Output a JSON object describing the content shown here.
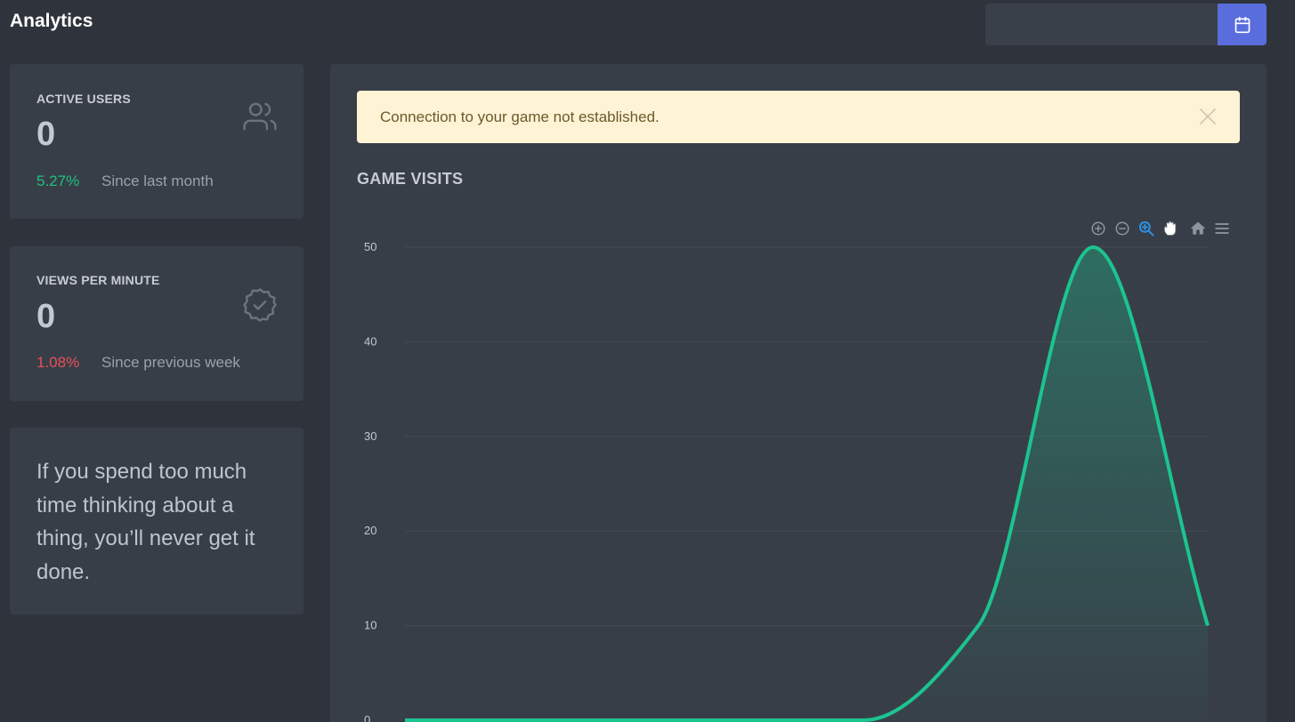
{
  "header": {
    "title": "Analytics",
    "date_value": "",
    "date_icon": "calendar-icon"
  },
  "stats": [
    {
      "title": "ACTIVE USERS",
      "value": "0",
      "change": "5.27%",
      "change_color": "#1fc17b",
      "since": "Since last month",
      "icon": "users-icon"
    },
    {
      "title": "VIEWS PER MINUTE",
      "value": "0",
      "change": "1.08%",
      "change_color": "#e9505a",
      "since": "Since previous week",
      "icon": "badge-check-icon"
    }
  ],
  "quote": {
    "text": "If you spend too much time thinking about a thing, you’ll never get it done."
  },
  "alert": {
    "message": "Connection to your game not established.",
    "close_icon": "close-icon"
  },
  "section": {
    "title": "GAME VISITS"
  },
  "toolbar": {
    "tools": [
      "zoom-in-icon",
      "zoom-out-icon",
      "selection-zoom-icon",
      "pan-icon",
      "home-icon",
      "menu-icon"
    ]
  },
  "colors": {
    "accent": "#5a6ddc",
    "series": "#1cc48f",
    "active_tool": "#2f8fe3"
  },
  "chart_data": {
    "type": "area",
    "title": "",
    "xlabel": "",
    "ylabel": "",
    "ylim": [
      0,
      50
    ],
    "y_ticks": [
      0,
      10,
      20,
      30,
      40,
      50
    ],
    "x": [
      0,
      1,
      2,
      3,
      4,
      5,
      6,
      7
    ],
    "series": [
      {
        "values": [
          0,
          0,
          0,
          0,
          0,
          10,
          50,
          10
        ]
      }
    ],
    "grid": true,
    "legend": "none"
  }
}
